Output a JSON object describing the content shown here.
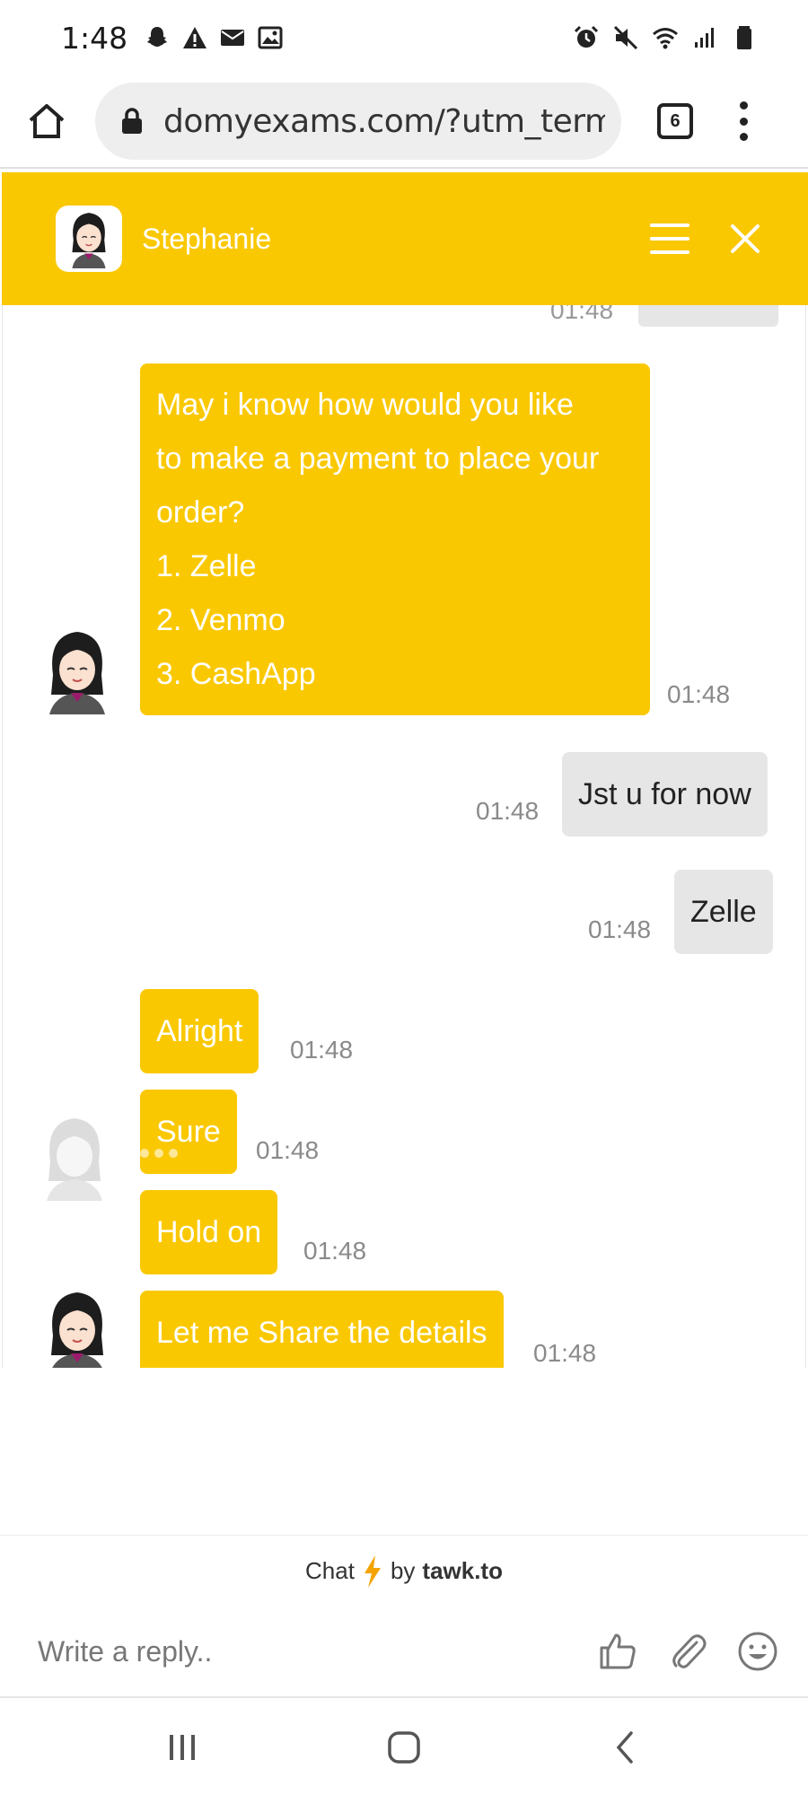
{
  "status_bar": {
    "time": "1:48",
    "left_icons": [
      "snapchat-icon",
      "warning-icon",
      "mail-icon",
      "image-icon"
    ],
    "right_icons": [
      "alarm-icon",
      "mute-icon",
      "wifi-icon",
      "signal-icon",
      "battery-icon"
    ]
  },
  "browser": {
    "url": "domyexams.com/?utm_term",
    "tab_count": "6"
  },
  "chat": {
    "agent_name": "Stephanie",
    "partial_time": "01:48",
    "messages": [
      {
        "from": "agent",
        "lines": [
          "May i know how would you like",
          "to make a payment to place your",
          "order?",
          "1. Zelle",
          "2. Venmo",
          "3. CashApp"
        ],
        "time": "01:48"
      },
      {
        "from": "user",
        "text": "Jst u for now",
        "time": "01:48"
      },
      {
        "from": "user",
        "text": "Zelle",
        "time": "01:48"
      },
      {
        "from": "agent",
        "text": "Alright",
        "time": "01:48"
      },
      {
        "from": "agent",
        "text": "Sure",
        "time": "01:48"
      },
      {
        "from": "agent",
        "text": "Hold on",
        "time": "01:48"
      },
      {
        "from": "agent",
        "text": "Let me Share the details",
        "time": "01:48"
      }
    ]
  },
  "branding": {
    "chat": "Chat",
    "by": "by",
    "brand": "tawk.to"
  },
  "reply": {
    "placeholder": "Write a reply.."
  },
  "colors": {
    "accent": "#fac800",
    "user_bubble": "#e6e6e6"
  }
}
